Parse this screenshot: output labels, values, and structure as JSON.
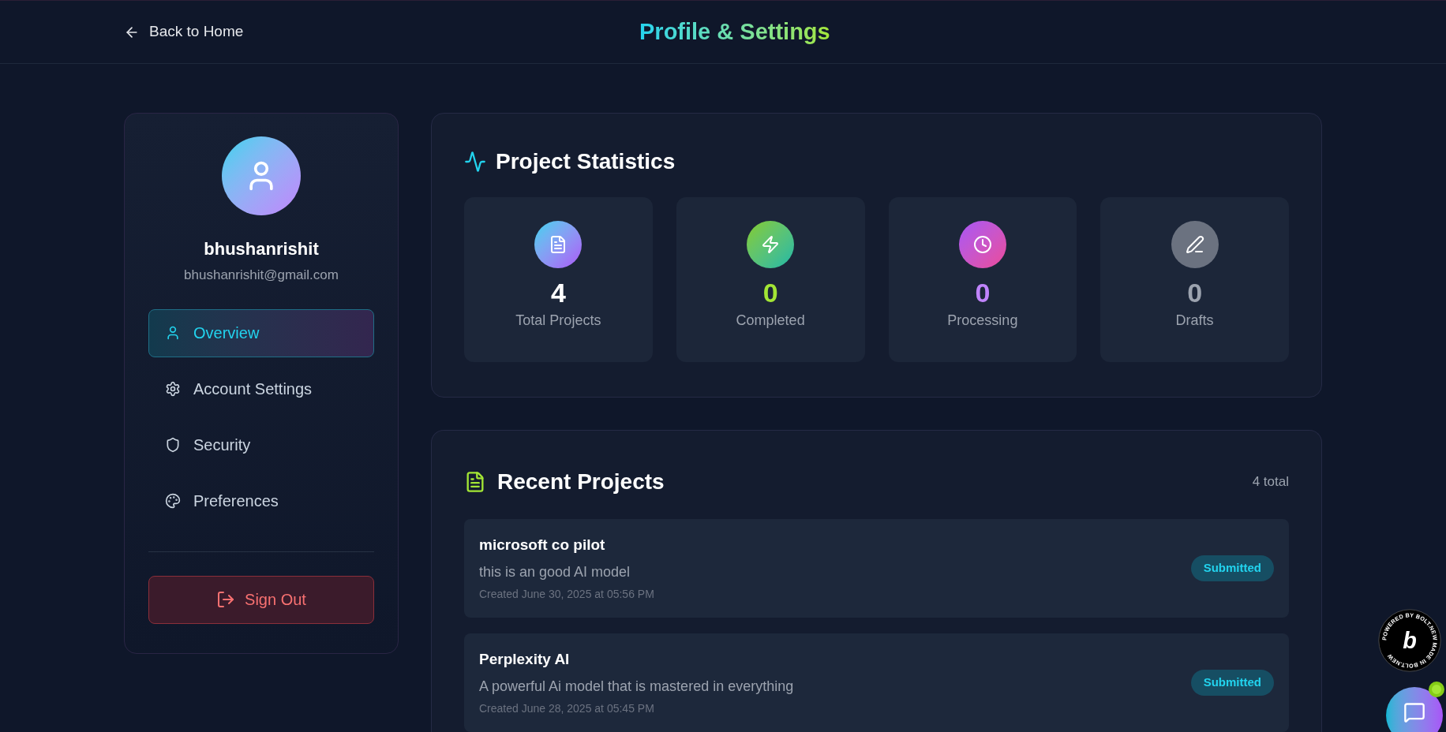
{
  "header": {
    "back_link": "Back to Home",
    "title": "Profile & Settings"
  },
  "profile": {
    "username": "bhushanrishit",
    "email": "bhushanrishit@gmail.com"
  },
  "nav": [
    {
      "label": "Overview",
      "selected": true
    },
    {
      "label": "Account Settings",
      "selected": false
    },
    {
      "label": "Security",
      "selected": false
    },
    {
      "label": "Preferences",
      "selected": false
    }
  ],
  "sign_out": "Sign Out",
  "stats": {
    "title": "Project Statistics",
    "items": [
      {
        "value": "4",
        "label": "Total Projects",
        "color": "#ffffff"
      },
      {
        "value": "0",
        "label": "Completed",
        "color": "#a3e635"
      },
      {
        "value": "0",
        "label": "Processing",
        "color": "#c084fc"
      },
      {
        "value": "0",
        "label": "Drafts",
        "color": "#9ca3af"
      }
    ]
  },
  "recent": {
    "title": "Recent Projects",
    "count": "4 total",
    "projects": [
      {
        "name": "microsoft co pilot",
        "description": "this is an good AI model",
        "created": "Created June 30, 2025 at 05:56 PM",
        "status": "Submitted"
      },
      {
        "name": "Perplexity AI",
        "description": "A powerful Ai model that is mastered in everything",
        "created": "Created June 28, 2025 at 05:45 PM",
        "status": "Submitted"
      }
    ]
  },
  "bolt_badge": {
    "ring_text": "POWERED BY BOLT.NEW MADE IN BOLT.NEW",
    "letter": "b"
  },
  "chat": {
    "online": true
  }
}
